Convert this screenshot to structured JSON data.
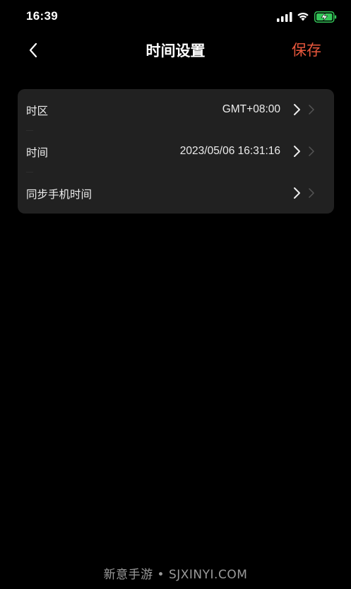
{
  "status_bar": {
    "time": "16:39",
    "signal_icon": "signal-icon",
    "wifi_icon": "wifi-icon",
    "battery_icon": "battery-charging-icon",
    "battery_color": "#34c759"
  },
  "nav": {
    "back_icon": "chevron-left-icon",
    "title": "时间设置",
    "save_label": "保存",
    "accent_color": "#e8573c"
  },
  "settings": {
    "rows": [
      {
        "label": "时区",
        "value": "GMT+08:00"
      },
      {
        "label": "时间",
        "value": "2023/05/06 16:31:16"
      },
      {
        "label": "同步手机时间",
        "value": ""
      }
    ]
  },
  "watermark": {
    "text": "新意手游 • SJXINYI.COM"
  }
}
